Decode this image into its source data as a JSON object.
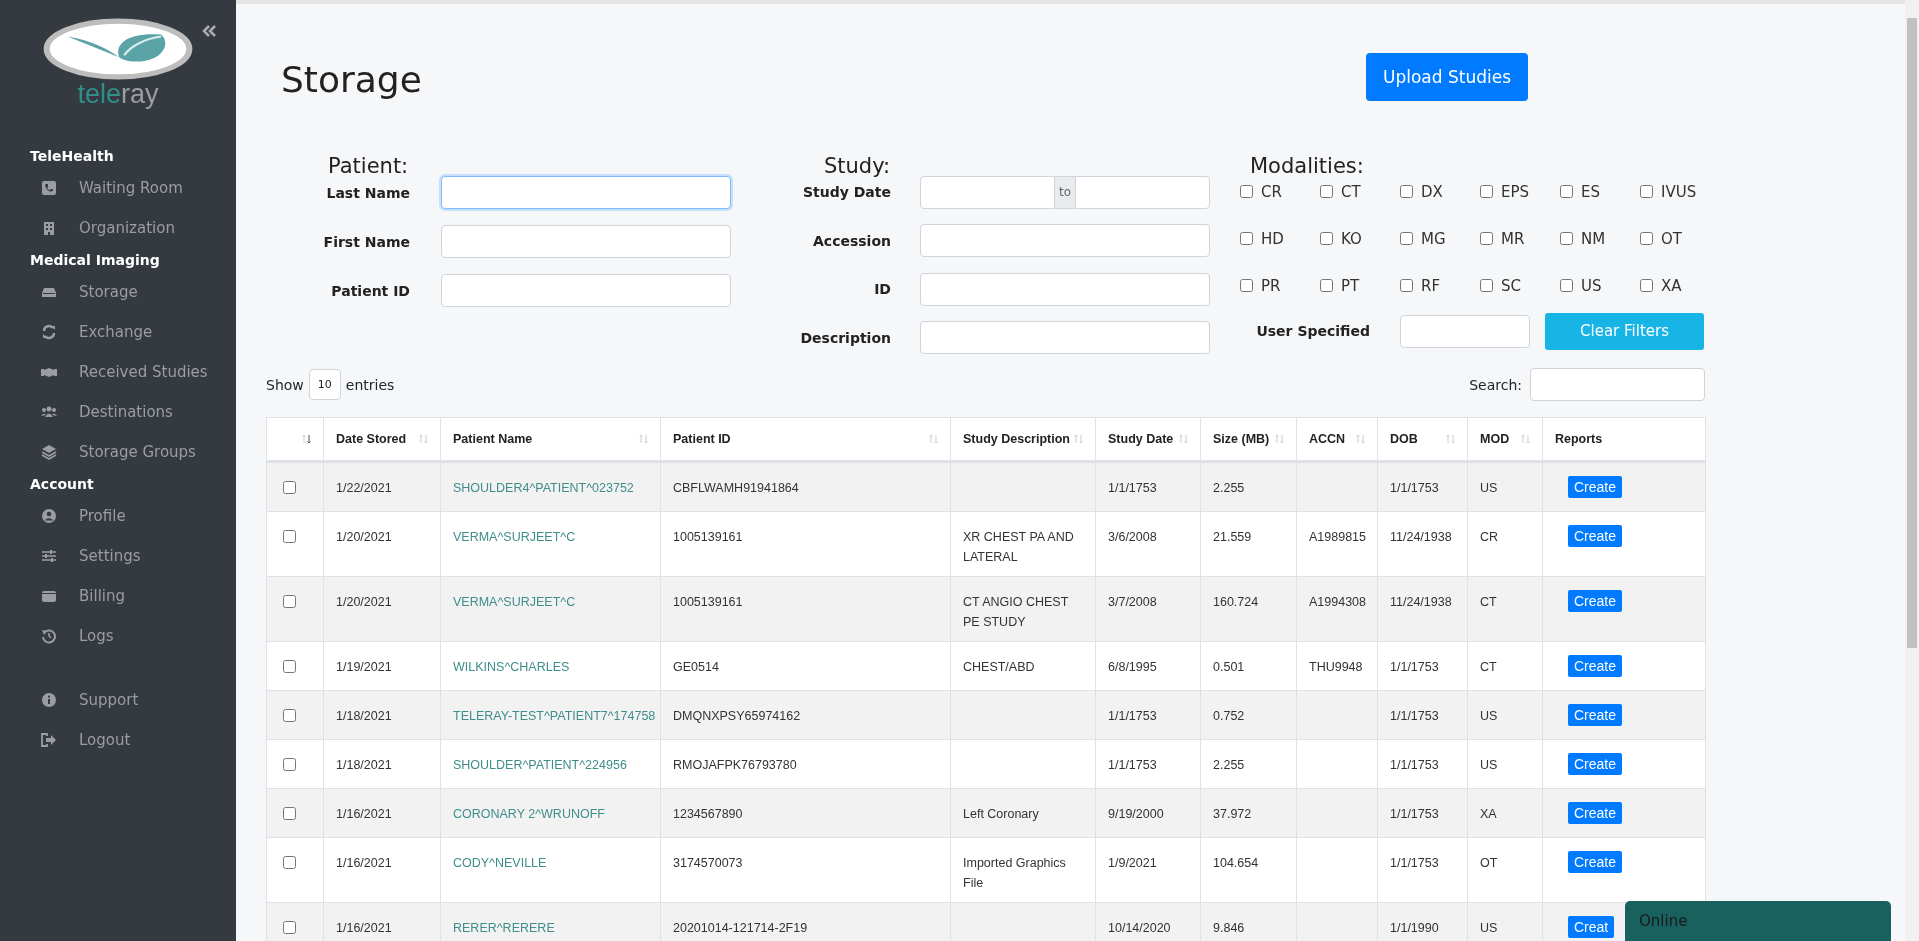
{
  "sidebar": {
    "logo_text_1": "tele",
    "logo_text_2": "ray",
    "sections": [
      {
        "title": "TeleHealth",
        "items": [
          {
            "label": "Waiting Room"
          },
          {
            "label": "Organization"
          }
        ]
      },
      {
        "title": "Medical Imaging",
        "items": [
          {
            "label": "Storage"
          },
          {
            "label": "Exchange"
          },
          {
            "label": "Received Studies"
          },
          {
            "label": "Destinations"
          },
          {
            "label": "Storage Groups"
          }
        ]
      },
      {
        "title": "Account",
        "items": [
          {
            "label": "Profile"
          },
          {
            "label": "Settings"
          },
          {
            "label": "Billing"
          },
          {
            "label": "Logs"
          }
        ]
      },
      {
        "items": [
          {
            "label": "Support"
          },
          {
            "label": "Logout"
          }
        ]
      }
    ]
  },
  "page_title": "Storage",
  "upload_button": "Upload Studies",
  "filters": {
    "patient": {
      "heading": "Patient:",
      "fields": [
        {
          "label": "Last Name",
          "focused": true
        },
        {
          "label": "First Name",
          "focused": false
        },
        {
          "label": "Patient ID",
          "focused": false
        }
      ]
    },
    "study": {
      "heading": "Study:",
      "date_label": "Study Date",
      "date_separator": "to",
      "fields": [
        {
          "label": "Accession"
        },
        {
          "label": "ID"
        },
        {
          "label": "Description"
        }
      ]
    },
    "modalities": {
      "heading": "Modalities:",
      "items": [
        {
          "label": "CR",
          "checked": false
        },
        {
          "label": "CT",
          "checked": false
        },
        {
          "label": "DX",
          "checked": false
        },
        {
          "label": "EPS",
          "checked": false
        },
        {
          "label": "ES",
          "checked": false
        },
        {
          "label": "IVUS",
          "checked": false
        },
        {
          "label": "HD",
          "checked": false
        },
        {
          "label": "KO",
          "checked": false
        },
        {
          "label": "MG",
          "checked": false
        },
        {
          "label": "MR",
          "checked": false
        },
        {
          "label": "NM",
          "checked": false
        },
        {
          "label": "OT",
          "checked": false
        },
        {
          "label": "PR",
          "checked": false
        },
        {
          "label": "PT",
          "checked": false
        },
        {
          "label": "RF",
          "checked": false
        },
        {
          "label": "SC",
          "checked": false
        },
        {
          "label": "US",
          "checked": false
        },
        {
          "label": "XA",
          "checked": false
        }
      ],
      "user_specified_label": "User Specified"
    },
    "clear_button": "Clear Filters"
  },
  "show_entries": {
    "before": "Show",
    "value": "10",
    "after": "entries"
  },
  "search_label": "Search:",
  "table": {
    "columns": [
      {
        "sorted": true
      },
      {
        "label": "Date Stored",
        "sorted": false
      },
      {
        "label": "Patient Name",
        "sorted": false
      },
      {
        "label": "Patient ID",
        "sorted": false
      },
      {
        "label": "Study Description",
        "sorted": false
      },
      {
        "label": "Study Date",
        "sorted": false
      },
      {
        "label": "Size (MB)",
        "sorted": false
      },
      {
        "label": "ACCN",
        "sorted": false
      },
      {
        "label": "DOB",
        "sorted": false
      },
      {
        "label": "MOD",
        "sorted": false
      },
      {
        "label": "Reports"
      }
    ],
    "rows": [
      {
        "checked": false,
        "date_stored": "1/22/2021",
        "patient_name": "SHOULDER4^PATIENT^023752",
        "patient_id": "CBFLWAMH91941864",
        "study_description": "",
        "study_date": "1/1/1753",
        "size": "2.255",
        "accn": "",
        "dob": "1/1/1753",
        "mod": "US",
        "report": "Create"
      },
      {
        "checked": false,
        "date_stored": "1/20/2021",
        "patient_name": "VERMA^SURJEET^C",
        "patient_id": "1005139161",
        "study_description": "XR CHEST PA AND LATERAL",
        "study_date": "3/6/2008",
        "size": "21.559",
        "accn": "A1989815",
        "dob": "11/24/1938",
        "mod": "CR",
        "report": "Create"
      },
      {
        "checked": false,
        "date_stored": "1/20/2021",
        "patient_name": "VERMA^SURJEET^C",
        "patient_id": "1005139161",
        "study_description": "CT ANGIO CHEST PE STUDY",
        "study_date": "3/7/2008",
        "size": "160.724",
        "accn": "A1994308",
        "dob": "11/24/1938",
        "mod": "CT",
        "report": "Create"
      },
      {
        "checked": false,
        "date_stored": "1/19/2021",
        "patient_name": "WILKINS^CHARLES",
        "patient_id": "GE0514",
        "study_description": "CHEST/ABD",
        "study_date": "6/8/1995",
        "size": "0.501",
        "accn": "THU9948",
        "dob": "1/1/1753",
        "mod": "CT",
        "report": "Create"
      },
      {
        "checked": false,
        "date_stored": "1/18/2021",
        "patient_name": "TELERAY-TEST^PATIENT7^174758",
        "patient_id": "DMQNXPSY65974162",
        "study_description": "",
        "study_date": "1/1/1753",
        "size": "0.752",
        "accn": "",
        "dob": "1/1/1753",
        "mod": "US",
        "report": "Create"
      },
      {
        "checked": false,
        "date_stored": "1/18/2021",
        "patient_name": "SHOULDER^PATIENT^224956",
        "patient_id": "RMOJAFPK76793780",
        "study_description": "",
        "study_date": "1/1/1753",
        "size": "2.255",
        "accn": "",
        "dob": "1/1/1753",
        "mod": "US",
        "report": "Create"
      },
      {
        "checked": false,
        "date_stored": "1/16/2021",
        "patient_name": "CORONARY 2^WRUNOFF",
        "patient_id": "1234567890",
        "study_description": "Left Coronary",
        "study_date": "9/19/2000",
        "size": "37.972",
        "accn": "",
        "dob": "1/1/1753",
        "mod": "XA",
        "report": "Create"
      },
      {
        "checked": false,
        "date_stored": "1/16/2021",
        "patient_name": "CODY^NEVILLE",
        "patient_id": "3174570073",
        "study_description": "Imported Graphics File",
        "study_date": "1/9/2021",
        "size": "104.654",
        "accn": "",
        "dob": "1/1/1753",
        "mod": "OT",
        "report": "Create"
      },
      {
        "checked": false,
        "date_stored": "1/16/2021",
        "patient_name": "RERER^RERERE",
        "patient_id": "20201014-121714-2F19",
        "study_description": "",
        "study_date": "10/14/2020",
        "size": "9.846",
        "accn": "",
        "dob": "1/1/1990",
        "mod": "US",
        "report": "Creat"
      }
    ]
  },
  "chat_widget": {
    "label": "Online"
  }
}
